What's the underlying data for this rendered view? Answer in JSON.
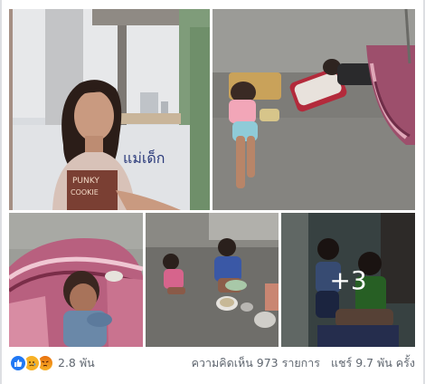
{
  "photos": {
    "photo1": {
      "name": "woman-portrait-photo",
      "handwriting": "แม่เด็ก",
      "shirt_text_1": "PUNKY",
      "shirt_text_2": "COOKIE"
    },
    "photo2": {
      "name": "children-sleeping-on-floor-photo"
    },
    "photo3": {
      "name": "child-in-hammock-photo"
    },
    "photo4": {
      "name": "children-eating-on-floor-photo"
    },
    "photo5": {
      "name": "children-sitting-photo",
      "more_label": "+3"
    }
  },
  "reactions": {
    "icons": [
      "like-icon",
      "sad-icon",
      "angry-icon"
    ],
    "count": "2.8 พัน"
  },
  "stats": {
    "comments": "ความคิดเห็น 973 รายการ",
    "shares": "แชร์ 9.7 พัน ครั้ง"
  },
  "colors": {
    "like": "#2078f4",
    "sad": "#f7b125",
    "text_secondary": "#606770",
    "card_bg": "#ffffff"
  }
}
